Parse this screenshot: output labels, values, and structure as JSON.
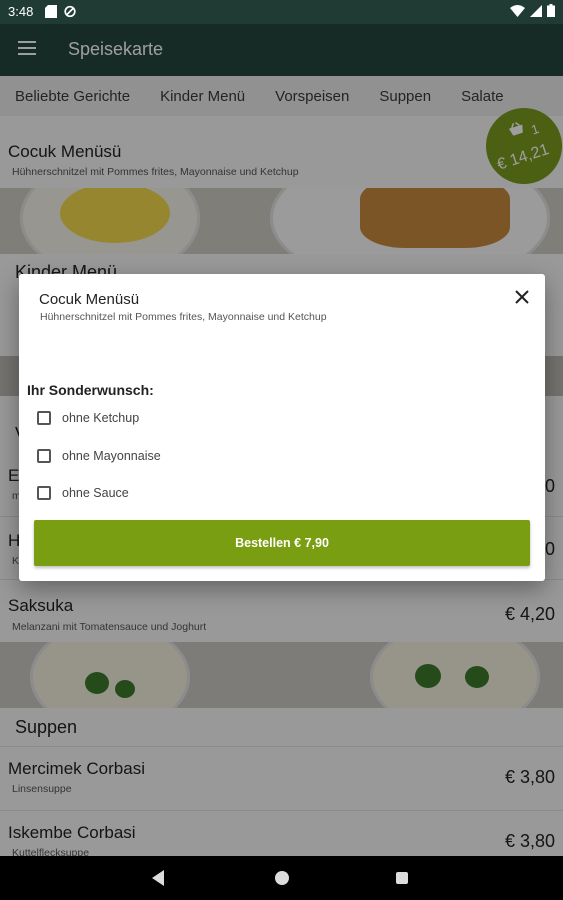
{
  "status": {
    "time": "3:48"
  },
  "appbar": {
    "title": "Speisekarte"
  },
  "tabs": [
    "Beliebte Gerichte",
    "Kinder Menü",
    "Vorspeisen",
    "Suppen",
    "Salate"
  ],
  "cart": {
    "count": "1",
    "amount": "€ 14,21"
  },
  "menu": {
    "top_item": {
      "name": "Cocuk Menüsü",
      "desc": "Hühnerschnitzel mit Pommes frites, Mayonnaise und Ketchup"
    },
    "section_kinder": "Kinder Menü",
    "section_v_partial": "V",
    "partial_rows": [
      {
        "letter": "E",
        "sub": "m",
        "price_fragment": "0"
      },
      {
        "letter": "H",
        "sub": "K",
        "price_fragment": "0"
      }
    ],
    "saksuka": {
      "name": "Saksuka",
      "desc": "Melanzani mit Tomatensauce und Joghurt",
      "price": "€ 4,20"
    },
    "section_suppen": "Suppen",
    "mercimek": {
      "name": "Mercimek Corbasi",
      "desc": "Linsensuppe",
      "price": "€ 3,80"
    },
    "iskembe": {
      "name": "Iskembe Corbasi",
      "desc": "Kuttelflecksuppe",
      "price": "€ 3,80"
    }
  },
  "dialog": {
    "title": "Cocuk Menüsü",
    "subtitle": "Hühnerschnitzel mit Pommes frites, Mayonnaise und Ketchup",
    "wish_label": "Ihr Sonderwunsch:",
    "options": [
      "ohne Ketchup",
      "ohne Mayonnaise",
      "ohne Sauce"
    ],
    "order_button": "Bestellen € 7,90"
  },
  "colors": {
    "appbar": "#24463d",
    "accent": "#7a9e12",
    "cart": "#7a9b1f"
  }
}
